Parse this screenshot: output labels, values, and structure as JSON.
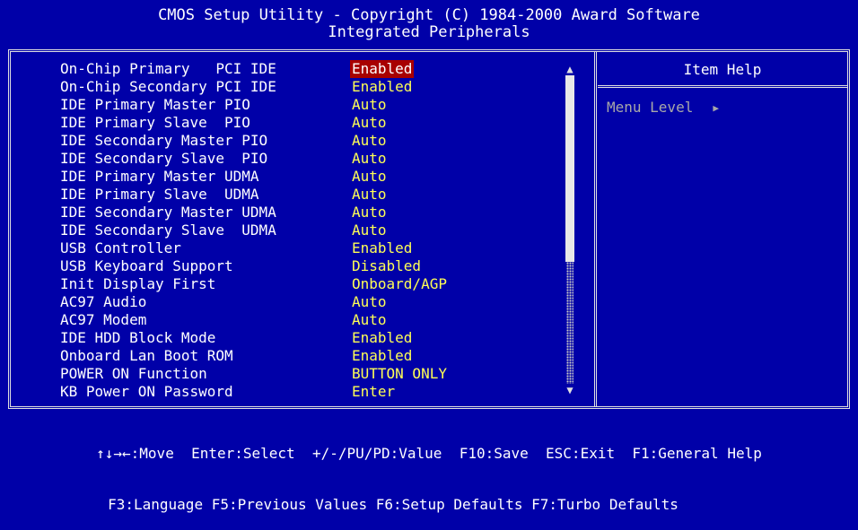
{
  "header": {
    "title": "CMOS Setup Utility - Copyright (C) 1984-2000 Award Software",
    "subtitle": "Integrated Peripherals"
  },
  "settings": [
    {
      "label": "On-Chip Primary   PCI IDE",
      "value": "Enabled",
      "selected": true
    },
    {
      "label": "On-Chip Secondary PCI IDE",
      "value": "Enabled"
    },
    {
      "label": "IDE Primary Master PIO",
      "value": "Auto"
    },
    {
      "label": "IDE Primary Slave  PIO",
      "value": "Auto"
    },
    {
      "label": "IDE Secondary Master PIO",
      "value": "Auto"
    },
    {
      "label": "IDE Secondary Slave  PIO",
      "value": "Auto"
    },
    {
      "label": "IDE Primary Master UDMA",
      "value": "Auto"
    },
    {
      "label": "IDE Primary Slave  UDMA",
      "value": "Auto"
    },
    {
      "label": "IDE Secondary Master UDMA",
      "value": "Auto"
    },
    {
      "label": "IDE Secondary Slave  UDMA",
      "value": "Auto"
    },
    {
      "label": "USB Controller",
      "value": "Enabled"
    },
    {
      "label": "USB Keyboard Support",
      "value": "Disabled"
    },
    {
      "label": "Init Display First",
      "value": "Onboard/AGP"
    },
    {
      "label": "AC97 Audio",
      "value": "Auto"
    },
    {
      "label": "AC97 Modem",
      "value": "Auto"
    },
    {
      "label": "IDE HDD Block Mode",
      "value": "Enabled"
    },
    {
      "label": "Onboard Lan Boot ROM",
      "value": "Enabled"
    },
    {
      "label": "POWER ON Function",
      "value": "BUTTON ONLY"
    },
    {
      "label": "KB Power ON Password",
      "value": "Enter"
    }
  ],
  "help": {
    "title": "Item Help",
    "menu_level": "Menu Level",
    "menu_level_icon": "triangle-right-icon"
  },
  "scrollbar": {
    "up_icon": "triangle-up-icon",
    "down_icon": "triangle-down-icon"
  },
  "footer": {
    "line1": "↑↓→←:Move  Enter:Select  +/-/PU/PD:Value  F10:Save  ESC:Exit  F1:General Help",
    "line2": "F3:Language F5:Previous Values F6:Setup Defaults F7:Turbo Defaults"
  },
  "colors": {
    "background": "#0000a8",
    "label": "#ffffff",
    "value": "#ffff55",
    "selected_background": "#a80000",
    "menu_level": "#a8a8a8"
  }
}
